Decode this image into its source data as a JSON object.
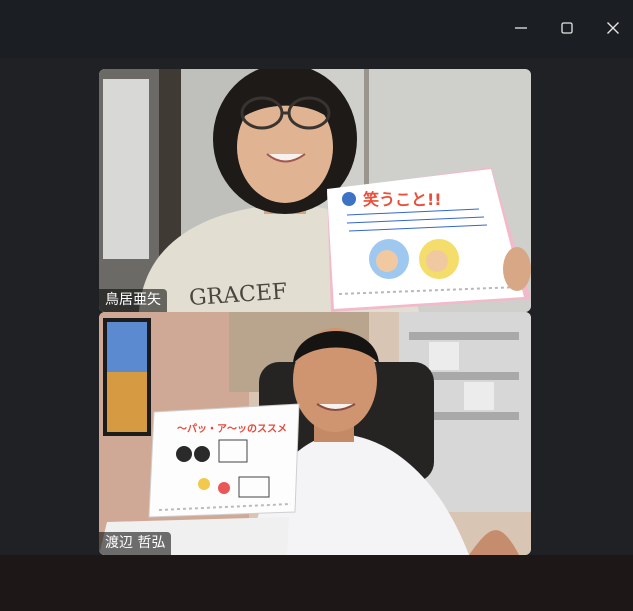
{
  "window": {
    "controls": [
      {
        "name": "minimize",
        "icon": "minimize-icon"
      },
      {
        "name": "maximize",
        "icon": "maximize-icon"
      },
      {
        "name": "close",
        "icon": "close-icon"
      }
    ]
  },
  "participants": [
    {
      "name": "鳥居亜矢",
      "board_title": "笑うこと!!",
      "shirt_text": "GRACEF"
    },
    {
      "name": "渡辺 哲弘",
      "board_title": "～パッ・ア～ッのススメ"
    }
  ],
  "colors": {
    "background": "#1b1e23",
    "name_tag_bg": "rgba(0,0,0,0.55)",
    "name_tag_text": "#ffffff"
  }
}
